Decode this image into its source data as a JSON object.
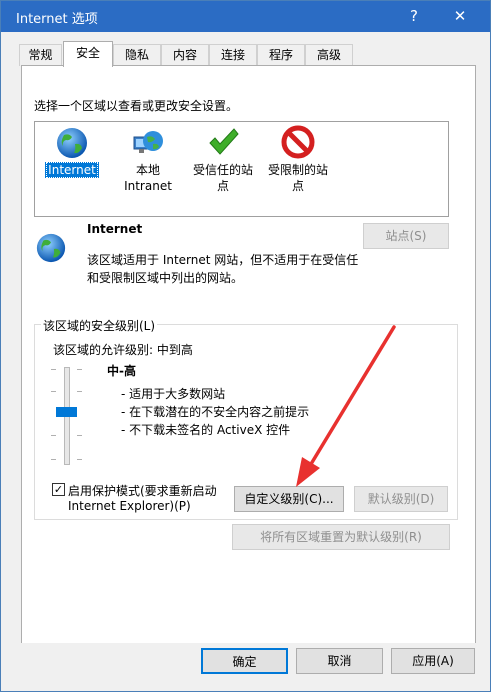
{
  "window": {
    "title": "Internet 选项",
    "help_label": "?",
    "close_label": "✕"
  },
  "tabs": [
    "常规",
    "安全",
    "隐私",
    "内容",
    "连接",
    "程序",
    "高级"
  ],
  "zones_section": {
    "instruction": "选择一个区域以查看或更改安全设置。",
    "zones": [
      {
        "line1": "Internet",
        "line2": "",
        "icon": "globe-icon"
      },
      {
        "line1": "本地",
        "line2": "Intranet",
        "icon": "intranet-icon"
      },
      {
        "line1": "受信任的站",
        "line2": "点",
        "icon": "checkmark-icon"
      },
      {
        "line1": "受限制的站",
        "line2": "点",
        "icon": "restricted-icon"
      }
    ]
  },
  "zone_info": {
    "name": "Internet",
    "desc_line1": "该区域适用于 Internet 网站，但不适用于在受信任",
    "desc_line2": "和受限制区域中列出的网站。",
    "sites_button": "站点(S)"
  },
  "security_level": {
    "group_label": "该区域的安全级别(L)",
    "allowed_levels": "该区域的允许级别: 中到高",
    "level_name": "中-高",
    "bullets": [
      "- 适用于大多数网站",
      "- 在下载潜在的不安全内容之前提示",
      "- 不下载未签名的 ActiveX 控件"
    ],
    "protected_mode_line1": "启用保护模式(要求重新启动",
    "protected_mode_line2": "Internet Explorer)(P)",
    "protected_mode_checked": true,
    "custom_level_button": "自定义级别(C)...",
    "default_level_button": "默认级别(D)",
    "reset_all_button": "将所有区域重置为默认级别(R)"
  },
  "footer": {
    "ok": "确定",
    "cancel": "取消",
    "apply": "应用(A)"
  },
  "colors": {
    "titlebar": "#2b6cc4",
    "selection": "#0078d7",
    "arrow": "#e8312f"
  }
}
